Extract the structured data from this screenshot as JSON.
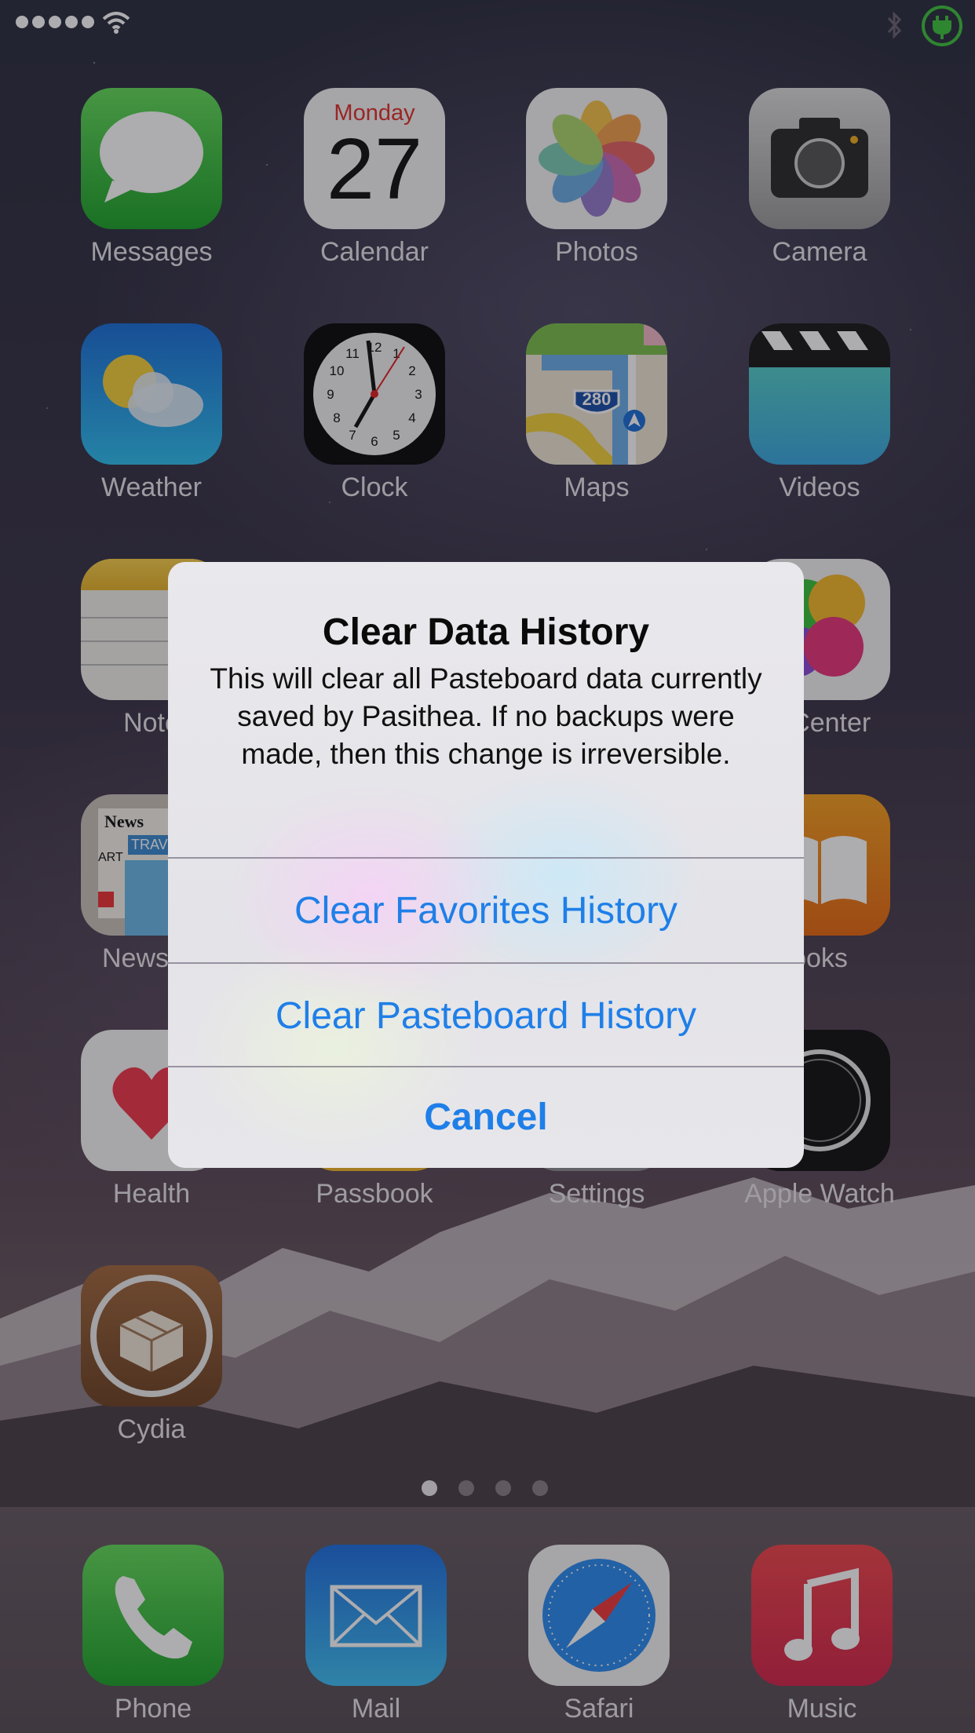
{
  "home": {
    "apps": [
      {
        "label": "Messages",
        "icon": "messages-icon"
      },
      {
        "label": "Calendar",
        "icon": "calendar-icon"
      },
      {
        "label": "Photos",
        "icon": "photos-icon"
      },
      {
        "label": "Camera",
        "icon": "camera-icon"
      },
      {
        "label": "Weather",
        "icon": "weather-icon"
      },
      {
        "label": "Clock",
        "icon": "clock-icon"
      },
      {
        "label": "Maps",
        "icon": "maps-icon"
      },
      {
        "label": "Videos",
        "icon": "videos-icon"
      },
      {
        "label": "Note",
        "icon": "notes-icon"
      },
      {
        "label": "e Center",
        "icon": "game-center-icon"
      },
      {
        "label": "Newss",
        "icon": "newsstand-icon"
      },
      {
        "label": "ooks",
        "icon": "ibooks-icon"
      },
      {
        "label": "Health",
        "icon": "health-icon"
      },
      {
        "label": "Passbook",
        "icon": "passbook-icon"
      },
      {
        "label": "Settings",
        "icon": "settings-icon"
      },
      {
        "label": "Apple Watch",
        "icon": "apple-watch-icon"
      },
      {
        "label": "Cydia",
        "icon": "cydia-icon"
      }
    ]
  },
  "calendar": {
    "day_name": "Monday",
    "day_number": "27"
  },
  "maps": {
    "shield": "280"
  },
  "newsstand": {
    "news": "News",
    "art": "ART",
    "travel": "TRAVE"
  },
  "dock": [
    {
      "label": "Phone",
      "icon": "phone-icon"
    },
    {
      "label": "Mail",
      "icon": "mail-icon"
    },
    {
      "label": "Safari",
      "icon": "safari-icon"
    },
    {
      "label": "Music",
      "icon": "music-icon"
    }
  ],
  "alert": {
    "title": "Clear Data History",
    "message": "This will clear all Pasteboard data currently saved by Pasithea. If no backups were made, then this change is irreversible.",
    "buttons": {
      "favorites": "Clear Favorites History",
      "pasteboard": "Clear Pasteboard History",
      "cancel": "Cancel"
    }
  },
  "colors": {
    "alert_button": "#1f7fe8",
    "battery_charging": "#3ec53e"
  }
}
